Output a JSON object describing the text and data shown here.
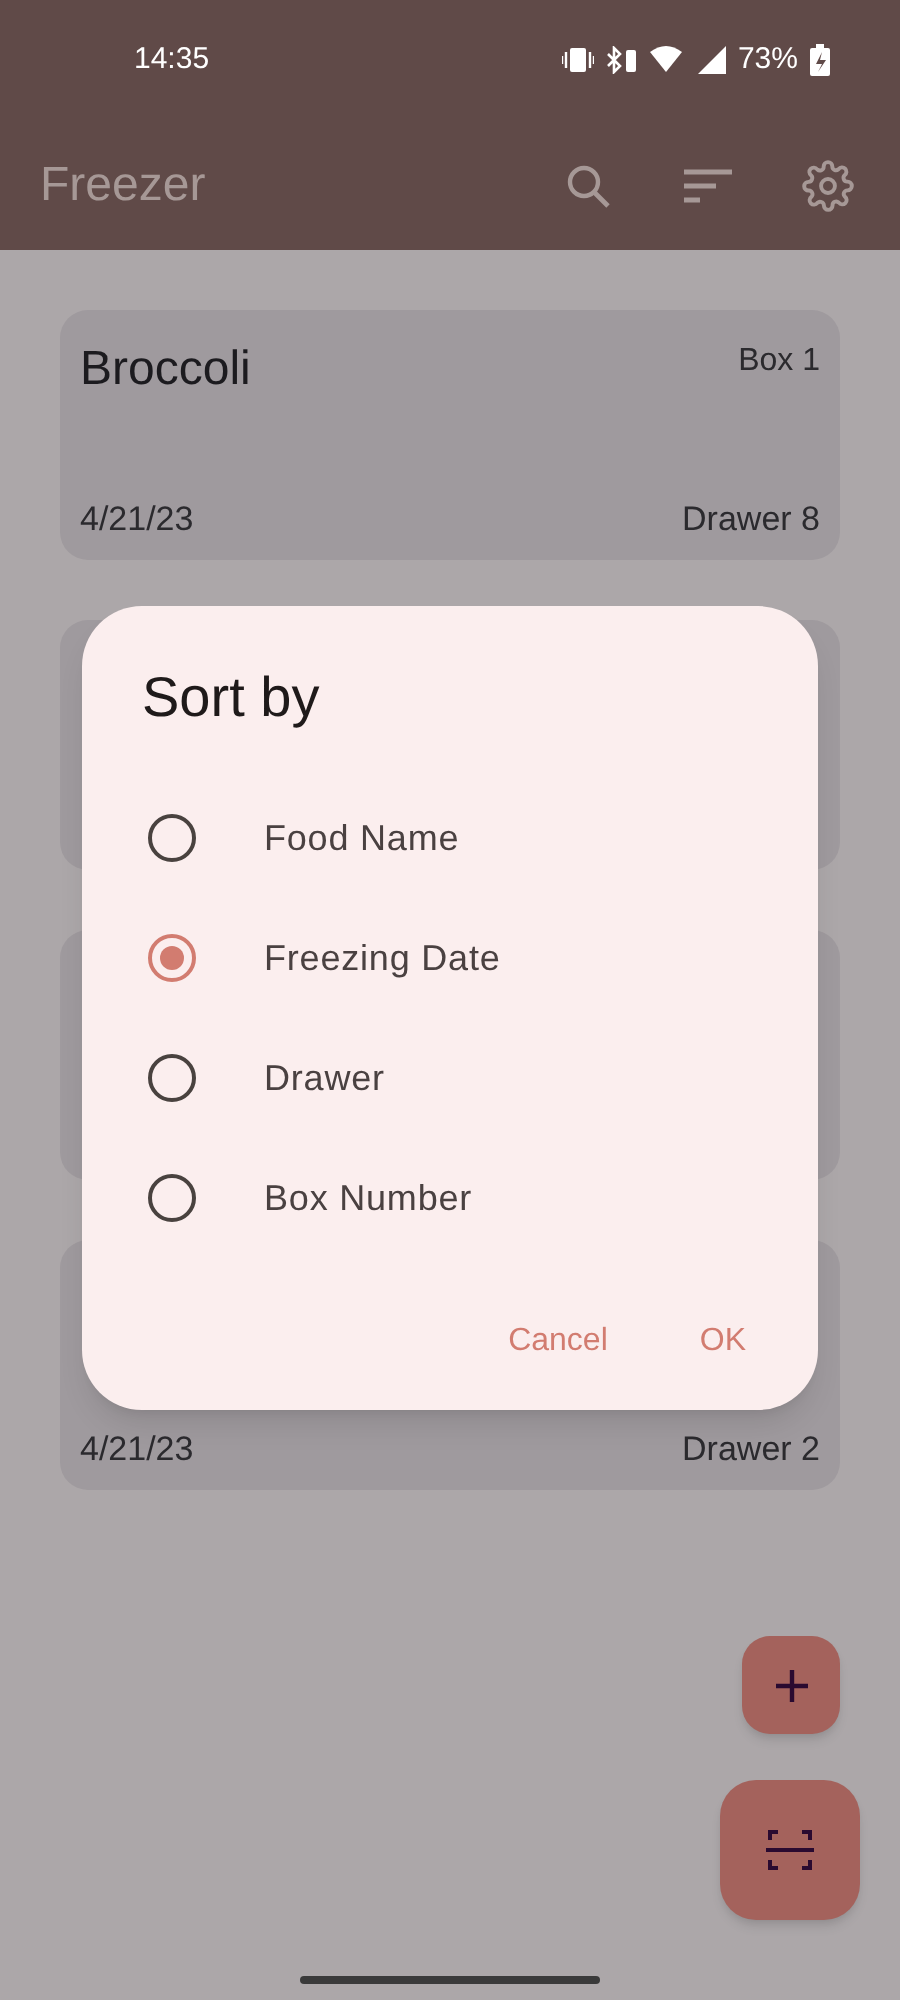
{
  "status_bar": {
    "time": "14:35",
    "battery": "73%"
  },
  "app_bar": {
    "title": "Freezer"
  },
  "cards": [
    {
      "kind": "card",
      "name": "Broccoli",
      "box": "Box 1",
      "date": "4/21/23",
      "drawer": "Drawer 8"
    },
    {
      "kind": "covered"
    },
    {
      "kind": "covered"
    },
    {
      "kind": "card",
      "date": "4/21/23",
      "drawer": "Drawer 2"
    }
  ],
  "dialog": {
    "title": "Sort by",
    "options": [
      {
        "label": "Food Name",
        "selected": false
      },
      {
        "label": "Freezing Date",
        "selected": true
      },
      {
        "label": "Drawer",
        "selected": false
      },
      {
        "label": "Box Number",
        "selected": false
      }
    ],
    "buttons": [
      "Cancel",
      "OK"
    ]
  }
}
